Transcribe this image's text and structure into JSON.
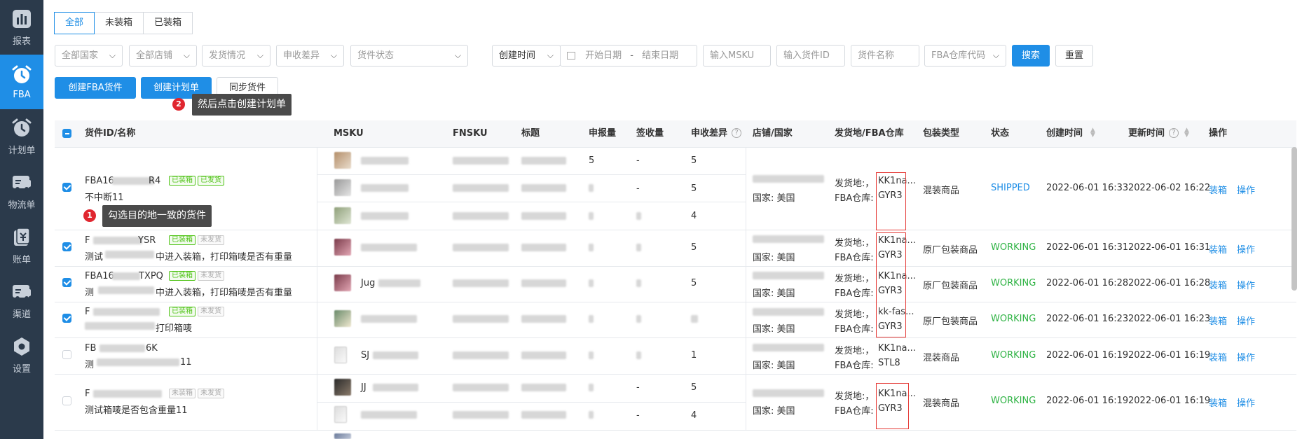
{
  "sidebar": {
    "items": [
      {
        "label": "报表",
        "icon": "bar-chart-icon"
      },
      {
        "label": "FBA",
        "icon": "alarm-clock-icon"
      },
      {
        "label": "计划单",
        "icon": "alarm-clock-icon"
      },
      {
        "label": "物流单",
        "icon": "truck-icon"
      },
      {
        "label": "账单",
        "icon": "bill-icon"
      },
      {
        "label": "渠道",
        "icon": "truck-icon"
      },
      {
        "label": "设置",
        "icon": "gear-icon"
      }
    ]
  },
  "tabs": [
    "全部",
    "未装箱",
    "已装箱"
  ],
  "filters": {
    "country": "全部国家",
    "shop": "全部店铺",
    "ship_status": "发货情况",
    "diff": "申收差异",
    "cargo_status": "货件状态",
    "time_type": "创建时间",
    "start_date": "开始日期",
    "dash": "-",
    "end_date": "结束日期",
    "msku": "输入MSKU",
    "cargo_id": "输入货件ID",
    "cargo_name": "货件名称",
    "fba_code": "FBA仓库代码",
    "search": "搜索",
    "reset": "重置"
  },
  "actions": {
    "create_fba": "创建FBA货件",
    "create_plan": "创建计划单",
    "sync": "同步货件"
  },
  "tips": {
    "step1_num": "1",
    "step1": "勾选目的地一致的货件",
    "step2_num": "2",
    "step2": "然后点击创建计划单"
  },
  "table": {
    "headers": {
      "id": "货件ID/名称",
      "msku": "MSKU",
      "fnsku": "FNSKU",
      "title": "标题",
      "declared": "申报量",
      "received": "签收量",
      "diff": "申收差异",
      "shop": "店铺/国家",
      "ship": "发货地/FBA仓库",
      "pack": "包装类型",
      "status": "状态",
      "created": "创建时间",
      "updated": "更新时间",
      "op": "操作"
    },
    "tag_boxed": "已装箱",
    "tag_unboxed": "未装箱",
    "tag_shipped": "已发货",
    "tag_unshipped": "未发货",
    "country_line": "国家: 美国",
    "fba_label": "FBA仓库:",
    "ship_label": "发货地:，",
    "btn_box": "装箱",
    "btn_op": "操作",
    "rows": [
      {
        "id": "FBA16",
        "id_tail": "R4",
        "name": "不中断11",
        "declared": [
          "5",
          "",
          ""
        ],
        "received": [
          "-",
          "-",
          ""
        ],
        "diff": [
          "5",
          "5",
          "4"
        ],
        "ship": "KK1na...",
        "fba": "GYR3",
        "pack": "混装商品",
        "status": "SHIPPED",
        "created": "2022-06-01 16:33",
        "updated": "2022-06-02 16:22"
      },
      {
        "id": "F",
        "id_tail": "YSR",
        "name_a": "测试",
        "name_b": "中进入装箱，打印箱唛是否有重量",
        "diff": [
          "5"
        ],
        "ship": "KK1na...",
        "fba": "GYR3",
        "pack": "原厂包装商品",
        "status": "WORKING",
        "created": "2022-06-01 16:31",
        "updated": "2022-06-01 16:31"
      },
      {
        "id": "FBA16",
        "id_tail": "TXPQ",
        "name_a": "测",
        "name_b": "中进入装箱，打印箱唛是否有重量",
        "msku_tail": "Jug",
        "diff": [
          "5"
        ],
        "ship": "KK1na...",
        "fba": "GYR3",
        "pack": "原厂包装商品",
        "status": "WORKING",
        "created": "2022-06-01 16:28",
        "updated": "2022-06-01 16:28"
      },
      {
        "id": "F",
        "id_tail": "",
        "name_b": "打印箱唛",
        "diff": [
          ""
        ],
        "ship": "kk-fas...",
        "fba": "GYR3",
        "pack": "原厂包装商品",
        "status": "WORKING",
        "created": "2022-06-01 16:23",
        "updated": "2022-06-01 16:23"
      },
      {
        "id": "FB",
        "id_tail": "6K",
        "name_a": "测",
        "name_b": "11",
        "msku_head": "SJ",
        "diff": [
          "1"
        ],
        "ship": "KK1na...",
        "fba": "STL8",
        "pack": "混装商品",
        "status": "WORKING",
        "created": "2022-06-01 16:19",
        "updated": "2022-06-01 16:19"
      },
      {
        "id": "F",
        "id_tail": "",
        "name_b": "测试箱唛是否包含重量11",
        "msku_head": "JJ",
        "diff": [
          "5",
          "4"
        ],
        "received": [
          "-",
          "-"
        ],
        "ship": "KK1na...",
        "fba": "GYR3",
        "pack": "混装商品",
        "status": "WORKING",
        "created": "2022-06-01 16:19",
        "updated": "2022-06-01 16:19"
      }
    ]
  },
  "colors": {
    "accent": "#1f8ee6",
    "sidebar": "#2b3a4b",
    "working": "#2fb344",
    "highlight": "#e53935"
  }
}
